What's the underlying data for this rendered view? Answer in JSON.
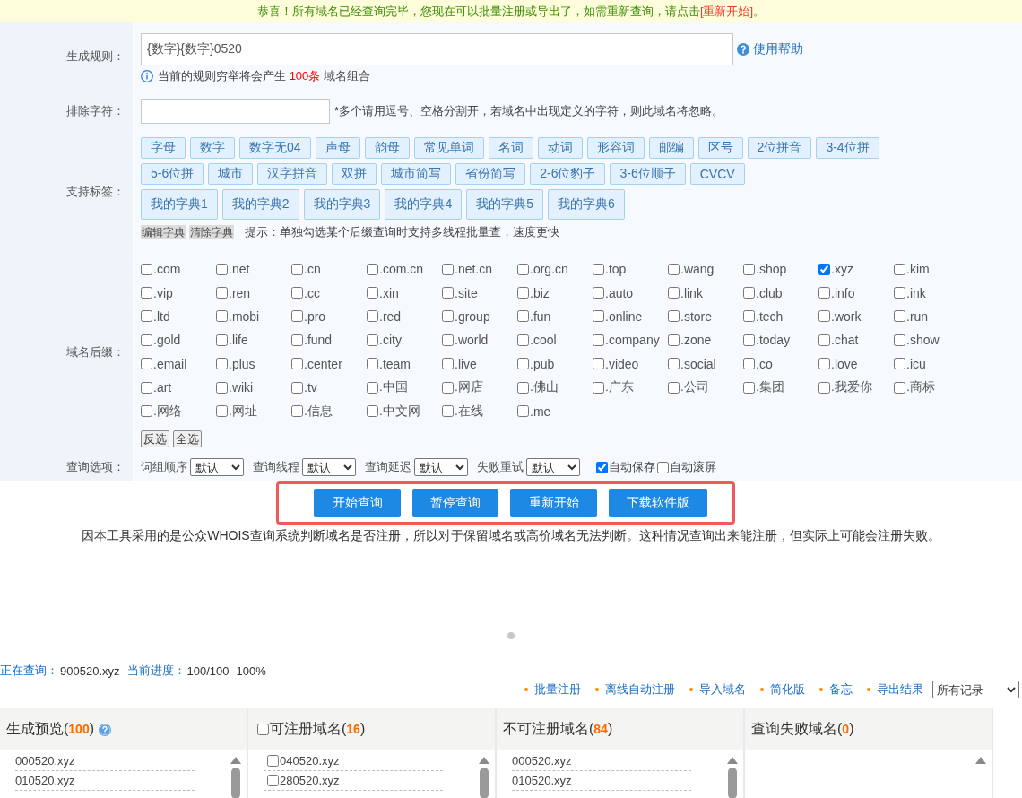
{
  "notice": {
    "text": "恭喜！所有域名已经查询完毕，您现在可以批量注册或导出了，如需重新查询，请点击",
    "link": "[重新开始]",
    "end": "。"
  },
  "rule": {
    "label": "生成规则：",
    "value": "{数字}{数字}0520",
    "help": "使用帮助",
    "info_before": "当前的规则穷举将会产生",
    "info_count": "100条",
    "info_after": "域名组合"
  },
  "exclude": {
    "label": "排除字符：",
    "hint": "*多个请用逗号、空格分割开，若域名中出现定义的字符，则此域名将忽略。"
  },
  "tags": {
    "label": "支持标签：",
    "items": [
      "字母",
      "数字",
      "数字无04",
      "声母",
      "韵母",
      "常见单词",
      "名词",
      "动词",
      "形容词",
      "邮编",
      "区号",
      "2位拼音",
      "3-4位拼",
      "5-6位拼",
      "城市",
      "汉字拼音",
      "双拼",
      "城市简写",
      "省份简写",
      "2-6位豹子",
      "3-6位顺子",
      "CVCV"
    ],
    "dictionaries": [
      "我的字典1",
      "我的字典2",
      "我的字典3",
      "我的字典4",
      "我的字典5",
      "我的字典6"
    ],
    "dict_actions": [
      "编辑字典",
      "清除字典"
    ],
    "tip": "提示：单独勾选某个后缀查询时支持多线程批量查，速度更快"
  },
  "suffixes": {
    "label": "域名后缀：",
    "items": [
      {
        "label": ".com",
        "checked": false
      },
      {
        "label": ".net",
        "checked": false
      },
      {
        "label": ".cn",
        "checked": false
      },
      {
        "label": ".com.cn",
        "checked": false
      },
      {
        "label": ".net.cn",
        "checked": false
      },
      {
        "label": ".org.cn",
        "checked": false
      },
      {
        "label": ".top",
        "checked": false
      },
      {
        "label": ".wang",
        "checked": false
      },
      {
        "label": ".shop",
        "checked": false
      },
      {
        "label": ".xyz",
        "checked": true
      },
      {
        "label": ".kim",
        "checked": false
      },
      {
        "label": ".vip",
        "checked": false
      },
      {
        "label": ".ren",
        "checked": false
      },
      {
        "label": ".cc",
        "checked": false
      },
      {
        "label": ".xin",
        "checked": false
      },
      {
        "label": ".site",
        "checked": false
      },
      {
        "label": ".biz",
        "checked": false
      },
      {
        "label": ".auto",
        "checked": false
      },
      {
        "label": ".link",
        "checked": false
      },
      {
        "label": ".club",
        "checked": false
      },
      {
        "label": ".info",
        "checked": false
      },
      {
        "label": ".ink",
        "checked": false
      },
      {
        "label": ".ltd",
        "checked": false
      },
      {
        "label": ".mobi",
        "checked": false
      },
      {
        "label": ".pro",
        "checked": false
      },
      {
        "label": ".red",
        "checked": false
      },
      {
        "label": ".group",
        "checked": false
      },
      {
        "label": ".fun",
        "checked": false
      },
      {
        "label": ".online",
        "checked": false
      },
      {
        "label": ".store",
        "checked": false
      },
      {
        "label": ".tech",
        "checked": false
      },
      {
        "label": ".work",
        "checked": false
      },
      {
        "label": ".run",
        "checked": false
      },
      {
        "label": ".gold",
        "checked": false
      },
      {
        "label": ".life",
        "checked": false
      },
      {
        "label": ".fund",
        "checked": false
      },
      {
        "label": ".city",
        "checked": false
      },
      {
        "label": ".world",
        "checked": false
      },
      {
        "label": ".cool",
        "checked": false
      },
      {
        "label": ".company",
        "checked": false
      },
      {
        "label": ".zone",
        "checked": false
      },
      {
        "label": ".today",
        "checked": false
      },
      {
        "label": ".chat",
        "checked": false
      },
      {
        "label": ".show",
        "checked": false
      },
      {
        "label": ".email",
        "checked": false
      },
      {
        "label": ".plus",
        "checked": false
      },
      {
        "label": ".center",
        "checked": false
      },
      {
        "label": ".team",
        "checked": false
      },
      {
        "label": ".live",
        "checked": false
      },
      {
        "label": ".pub",
        "checked": false
      },
      {
        "label": ".video",
        "checked": false
      },
      {
        "label": ".social",
        "checked": false
      },
      {
        "label": ".co",
        "checked": false
      },
      {
        "label": ".love",
        "checked": false
      },
      {
        "label": ".icu",
        "checked": false
      },
      {
        "label": ".art",
        "checked": false
      },
      {
        "label": ".wiki",
        "checked": false
      },
      {
        "label": ".tv",
        "checked": false
      },
      {
        "label": ".中国",
        "checked": false
      },
      {
        "label": ".网店",
        "checked": false
      },
      {
        "label": ".佛山",
        "checked": false
      },
      {
        "label": ".广东",
        "checked": false
      },
      {
        "label": ".公司",
        "checked": false
      },
      {
        "label": ".集团",
        "checked": false
      },
      {
        "label": ".我爱你",
        "checked": false
      },
      {
        "label": ".商标",
        "checked": false
      },
      {
        "label": ".网络",
        "checked": false
      },
      {
        "label": ".网址",
        "checked": false
      },
      {
        "label": ".信息",
        "checked": false
      },
      {
        "label": ".中文网",
        "checked": false
      },
      {
        "label": ".在线",
        "checked": false
      },
      {
        "label": ".me",
        "checked": false
      }
    ],
    "buttons": [
      "反选",
      "全选"
    ]
  },
  "options": {
    "label": "查询选项：",
    "selects": [
      {
        "label": "词组顺序",
        "value": "默认"
      },
      {
        "label": "查询线程",
        "value": "默认"
      },
      {
        "label": "查询延迟",
        "value": "默认"
      },
      {
        "label": "失败重试",
        "value": "默认"
      }
    ],
    "checkboxes": [
      {
        "label": "自动保存",
        "checked": true
      },
      {
        "label": "自动滚屏",
        "checked": false
      }
    ]
  },
  "actions": [
    "开始查询",
    "暂停查询",
    "重新开始",
    "下载软件版"
  ],
  "disclaimer": "因本工具采用的是公众WHOIS查询系统判断域名是否注册，所以对于保留域名或高价域名无法判断。这种情况查询出来能注册，但实际上可能会注册失败。",
  "status": {
    "querying_label": "正在查询：",
    "querying_value": "900520.xyz",
    "progress_label": "当前进度：",
    "progress_count": "100/100",
    "progress_percent": "100%"
  },
  "links": [
    "批量注册",
    "离线自动注册",
    "导入域名",
    "简化版",
    "备忘",
    "导出结果"
  ],
  "export_filter": "所有记录",
  "panels": [
    {
      "kind": "preview",
      "title": "生成预览(**100**)",
      "items": [
        {
          "label": "000520.xyz"
        },
        {
          "label": "010520.xyz"
        }
      ]
    },
    {
      "kind": "checkable",
      "title": "可注册域名(**16**)",
      "checked": false,
      "items": [
        {
          "label": "040520.xyz",
          "checked": false
        },
        {
          "label": "280520.xyz",
          "checked": false
        }
      ]
    },
    {
      "kind": "plain",
      "title": "不可注册域名(**84**)",
      "items": [
        {
          "label": "000520.xyz"
        },
        {
          "label": "010520.xyz"
        }
      ]
    },
    {
      "kind": "plain",
      "title": "查询失败域名(**0**)"
    }
  ]
}
